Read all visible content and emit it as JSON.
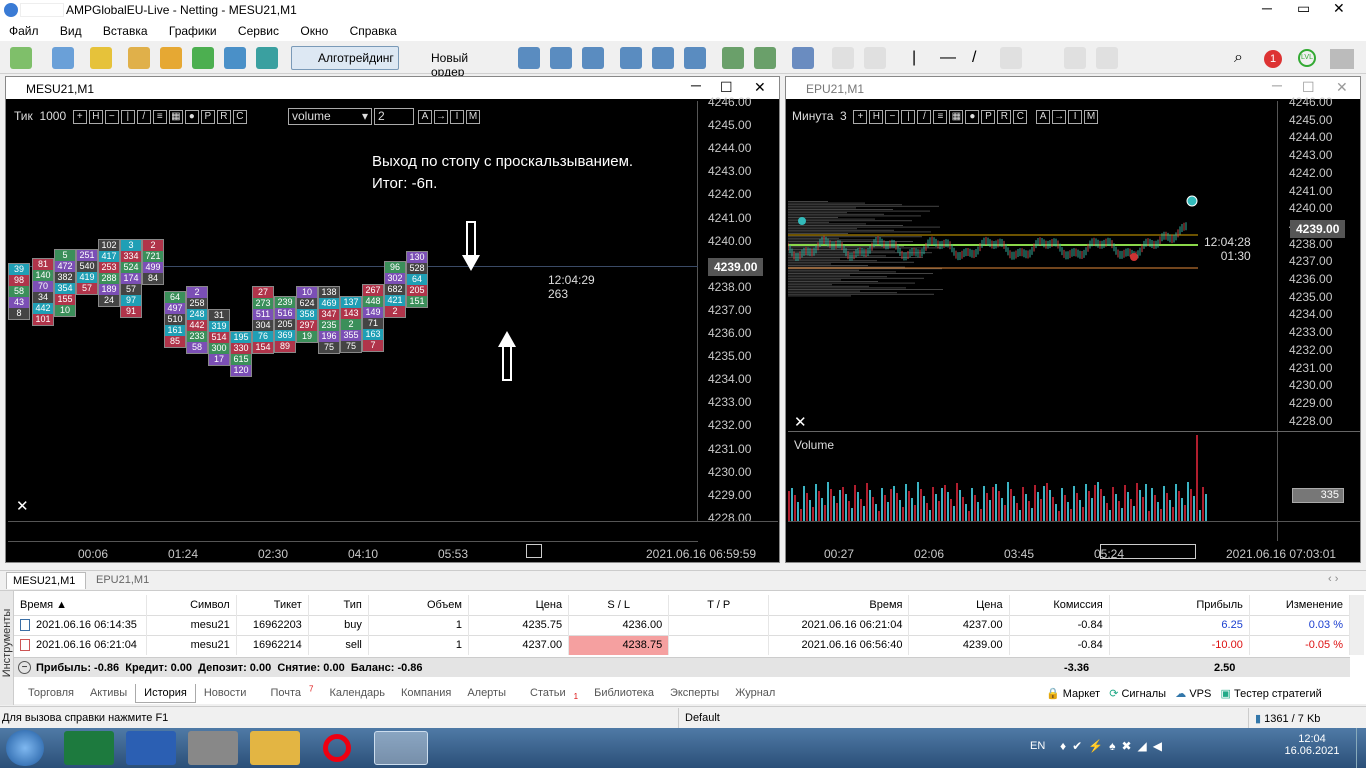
{
  "title": "AMPGlobalEU-Live - Netting - MESU21,M1",
  "menu": [
    "Файл",
    "Вид",
    "Вставка",
    "Графики",
    "Сервис",
    "Окно",
    "Справка"
  ],
  "toolbar": {
    "algo": "Алготрейдинг",
    "new_order": "Новый ордер",
    "notif_count": "1",
    "lvl": "LVL"
  },
  "left_chart": {
    "title": "MESU21,M1",
    "tick_label": "Тик",
    "tick_value": "1000",
    "indicator": "volume",
    "period": "2",
    "annotation_line1": "Выход по стопу с проскальзыванием.",
    "annotation_line2": "Итог: -6п.",
    "price_axis": [
      "4246.00",
      "4245.00",
      "4244.00",
      "4243.00",
      "4242.00",
      "4241.00",
      "4240.00",
      "4239.00",
      "4238.00",
      "4237.00",
      "4236.00",
      "4235.00",
      "4234.00",
      "4233.00",
      "4232.00",
      "4231.00",
      "4230.00",
      "4229.00",
      "4228.00"
    ],
    "current_price": "4239.00",
    "timer_time": "12:04:29",
    "timer_count": "263",
    "time_axis": [
      "00:06",
      "01:24",
      "02:30",
      "04:10",
      "05:53"
    ],
    "datetime": "2021.06.16 06:59:59",
    "clusters": [
      [
        "39",
        "98",
        "58",
        "43",
        "8"
      ],
      [
        "81",
        "140",
        "70",
        "34",
        "442",
        "101"
      ],
      [
        "5",
        "472",
        "382",
        "354",
        "155",
        "10"
      ],
      [
        "251",
        "540",
        "419",
        "57"
      ],
      [
        "102",
        "417",
        "253",
        "288",
        "189",
        "24"
      ],
      [
        "3",
        "334",
        "524",
        "174",
        "57",
        "97",
        "91"
      ],
      [
        "2",
        "721",
        "499",
        "84"
      ],
      [
        "64",
        "497",
        "510",
        "161",
        "85"
      ],
      [
        "2",
        "258",
        "248",
        "442",
        "233",
        "58"
      ],
      [
        "31",
        "319",
        "514",
        "300",
        "17"
      ],
      [
        "195",
        "330",
        "615",
        "120"
      ],
      [
        "27",
        "273",
        "511",
        "304",
        "76",
        "154"
      ],
      [
        "239",
        "516",
        "205",
        "369",
        "89"
      ],
      [
        "10",
        "624",
        "358",
        "297",
        "19"
      ],
      [
        "138",
        "469",
        "347",
        "235",
        "196",
        "75"
      ],
      [
        "137",
        "143",
        "2",
        "355",
        "75"
      ],
      [
        "267",
        "448",
        "149",
        "71",
        "163",
        "7"
      ],
      [
        "96",
        "302",
        "682",
        "421",
        "2"
      ],
      [
        "130",
        "528",
        "64",
        "205",
        "151"
      ]
    ]
  },
  "right_chart": {
    "title": "EPU21,M1",
    "tf_label": "Минута",
    "tf_value": "3",
    "price_axis": [
      "4246.00",
      "4245.00",
      "4244.00",
      "4243.00",
      "4242.00",
      "4241.00",
      "4240.00",
      "4239.00",
      "4238.00",
      "4237.00",
      "4236.00",
      "4235.00",
      "4234.00",
      "4233.00",
      "4232.00",
      "4231.00",
      "4230.00",
      "4229.00",
      "4228.00"
    ],
    "current_price": "4239.00",
    "timer_time": "12:04:28",
    "timer_count": "01:30",
    "volume_label": "Volume",
    "volume_value": "335",
    "time_axis": [
      "00:27",
      "02:06",
      "03:45",
      "05:24"
    ],
    "datetime": "2021.06.16 07:03:01"
  },
  "chart_tabs": [
    "MESU21,M1",
    "EPU21,M1"
  ],
  "history": {
    "columns": [
      "Время",
      "Символ",
      "Тикет",
      "Тип",
      "Объем",
      "Цена",
      "S / L",
      "T / P",
      "Время",
      "Цена",
      "Комиссия",
      "Прибыль",
      "Изменение"
    ],
    "rows": [
      [
        "2021.06.16 06:14:35",
        "mesu21",
        "16962203",
        "buy",
        "1",
        "4235.75",
        "4236.00",
        "",
        "2021.06.16 06:21:04",
        "4237.00",
        "-0.84",
        "6.25",
        "0.03 %"
      ],
      [
        "2021.06.16 06:21:04",
        "mesu21",
        "16962214",
        "sell",
        "1",
        "4237.00",
        "4238.75",
        "",
        "2021.06.16 06:56:40",
        "4239.00",
        "-0.84",
        "-10.00",
        "-0.05 %"
      ]
    ],
    "summary": "Прибыль: -0.86  Кредит: 0.00  Депозит: 0.00  Снятие: 0.00  Баланс: -0.86",
    "total_commission": "-3.36",
    "total_profit": "2.50"
  },
  "side_label": "Инструменты",
  "bottom_tabs": [
    "Торговля",
    "Активы",
    "История",
    "Новости",
    "Почта",
    "Календарь",
    "Компания",
    "Алерты",
    "Статьи",
    "Библиотека",
    "Эксперты",
    "Журнал"
  ],
  "mail_badge": "7",
  "articles_badge": "1",
  "right_links": [
    "Маркет",
    "Сигналы",
    "VPS",
    "Тестер стратегий"
  ],
  "status": {
    "help": "Для вызова справки нажмите F1",
    "profile": "Default",
    "traffic": "1361 / 7 Kb"
  },
  "tray": {
    "lang": "EN",
    "time": "12:04",
    "date": "16.06.2021"
  }
}
